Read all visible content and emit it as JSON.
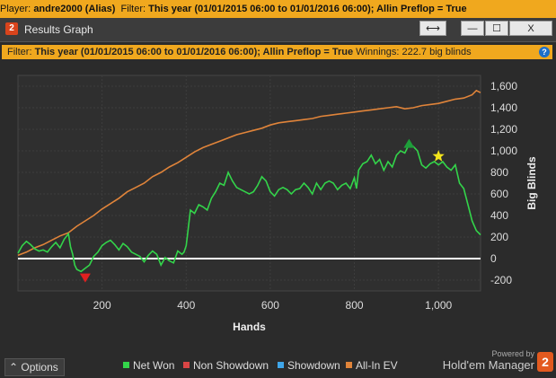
{
  "topbar": {
    "player_label": "Player:",
    "player_value": "andre2000 (Alias)",
    "filter_label": "Filter:",
    "filter_value": "This year (01/01/2015 06:00 to 01/01/2016 06:00); Allin Preflop = True"
  },
  "window": {
    "icon_text": "2",
    "title": "Results Graph",
    "buttons": {
      "resize": "⟷",
      "minimize": "—",
      "maximize": "☐",
      "close": "X"
    }
  },
  "filterbar": {
    "filter_label": "Filter:",
    "filter_value": "This year (01/01/2015 06:00 to 01/01/2016 06:00); Allin Preflop = True",
    "winnings_label": "Winnings:",
    "winnings_value": "222.7 big blinds",
    "help": "?"
  },
  "chart_data": {
    "type": "line",
    "xlabel": "Hands",
    "ylabel": "Big Blinds",
    "xlim": [
      0,
      1100
    ],
    "ylim": [
      -300,
      1700
    ],
    "x_ticks": [
      200,
      400,
      600,
      800,
      1000
    ],
    "x_tick_labels": [
      "200",
      "400",
      "600",
      "800",
      "1,000"
    ],
    "y_ticks": [
      -200,
      0,
      200,
      400,
      600,
      800,
      1000,
      1200,
      1400,
      1600
    ],
    "y_tick_labels": [
      "-200",
      "0",
      "200",
      "400",
      "600",
      "800",
      "1,000",
      "1,200",
      "1,400",
      "1,600"
    ],
    "grid": true,
    "series": [
      {
        "name": "Net Won",
        "color": "#33d44a",
        "x": [
          0,
          10,
          20,
          30,
          40,
          50,
          60,
          70,
          80,
          90,
          100,
          110,
          120,
          125,
          130,
          135,
          140,
          150,
          160,
          170,
          180,
          190,
          200,
          210,
          220,
          230,
          240,
          250,
          260,
          270,
          280,
          290,
          300,
          310,
          320,
          330,
          340,
          350,
          360,
          370,
          380,
          390,
          395,
          400,
          410,
          420,
          430,
          440,
          450,
          460,
          470,
          480,
          490,
          500,
          510,
          520,
          530,
          540,
          550,
          560,
          570,
          580,
          590,
          600,
          610,
          620,
          630,
          640,
          650,
          660,
          670,
          680,
          690,
          700,
          710,
          720,
          730,
          740,
          750,
          760,
          770,
          780,
          790,
          800,
          805,
          810,
          820,
          830,
          840,
          850,
          860,
          870,
          880,
          890,
          900,
          910,
          920,
          930,
          940,
          950,
          960,
          970,
          980,
          990,
          1000,
          1010,
          1020,
          1030,
          1040,
          1050,
          1060,
          1070,
          1080,
          1090,
          1100
        ],
        "y": [
          50,
          120,
          160,
          130,
          90,
          70,
          80,
          60,
          110,
          150,
          100,
          180,
          230,
          110,
          40,
          -60,
          -100,
          -120,
          -90,
          -60,
          20,
          60,
          120,
          150,
          170,
          130,
          80,
          140,
          110,
          60,
          40,
          20,
          -30,
          30,
          70,
          40,
          -60,
          10,
          -20,
          -40,
          70,
          40,
          60,
          120,
          450,
          420,
          500,
          480,
          450,
          560,
          620,
          700,
          680,
          800,
          720,
          660,
          640,
          620,
          600,
          620,
          680,
          760,
          720,
          620,
          580,
          640,
          660,
          640,
          600,
          640,
          650,
          700,
          660,
          600,
          700,
          640,
          700,
          720,
          700,
          640,
          680,
          700,
          650,
          750,
          650,
          820,
          880,
          900,
          960,
          880,
          920,
          820,
          900,
          850,
          960,
          1000,
          980,
          1060,
          1040,
          1000,
          870,
          840,
          880,
          900,
          870,
          900,
          850,
          820,
          870,
          700,
          650,
          500,
          350,
          260,
          220
        ]
      },
      {
        "name": "Non Showdown",
        "color": "#d94545",
        "x": [],
        "y": []
      },
      {
        "name": "Showdown",
        "color": "#3fa6ea",
        "x": [],
        "y": []
      },
      {
        "name": "All-In EV",
        "color": "#e0843a",
        "x": [
          0,
          20,
          40,
          60,
          80,
          100,
          120,
          140,
          160,
          180,
          200,
          220,
          240,
          260,
          280,
          300,
          320,
          340,
          360,
          380,
          400,
          420,
          440,
          460,
          480,
          500,
          520,
          540,
          560,
          580,
          600,
          620,
          640,
          660,
          680,
          700,
          720,
          740,
          760,
          780,
          800,
          820,
          840,
          860,
          880,
          900,
          920,
          940,
          960,
          980,
          1000,
          1020,
          1040,
          1060,
          1080,
          1090,
          1100
        ],
        "y": [
          30,
          60,
          100,
          130,
          170,
          210,
          240,
          300,
          350,
          400,
          460,
          510,
          560,
          620,
          660,
          700,
          760,
          800,
          850,
          890,
          940,
          990,
          1030,
          1060,
          1090,
          1120,
          1150,
          1170,
          1190,
          1210,
          1240,
          1260,
          1270,
          1280,
          1290,
          1300,
          1320,
          1330,
          1340,
          1350,
          1360,
          1370,
          1380,
          1390,
          1400,
          1410,
          1390,
          1400,
          1420,
          1430,
          1440,
          1460,
          1480,
          1490,
          1520,
          1560,
          1540
        ]
      }
    ],
    "markers": [
      {
        "name": "minimum",
        "x": 160,
        "y": -180,
        "color": "#e02020",
        "shape": "triangle-down"
      },
      {
        "name": "maximum",
        "x": 930,
        "y": 1070,
        "color": "#1e9e3a",
        "shape": "triangle-up"
      },
      {
        "name": "star",
        "x": 1000,
        "y": 950,
        "color": "#f4e51c",
        "shape": "star"
      }
    ],
    "baseline": 0
  },
  "bottombar": {
    "options_label": "Options",
    "legend": [
      {
        "label": "Net Won",
        "color": "#33d44a"
      },
      {
        "label": "Non Showdown",
        "color": "#d94545"
      },
      {
        "label": "Showdown",
        "color": "#3fa6ea"
      },
      {
        "label": "All-In EV",
        "color": "#e0843a"
      }
    ],
    "powered_by": "Powered by",
    "brand": "Hold'em Manager",
    "brand_badge": "2"
  }
}
